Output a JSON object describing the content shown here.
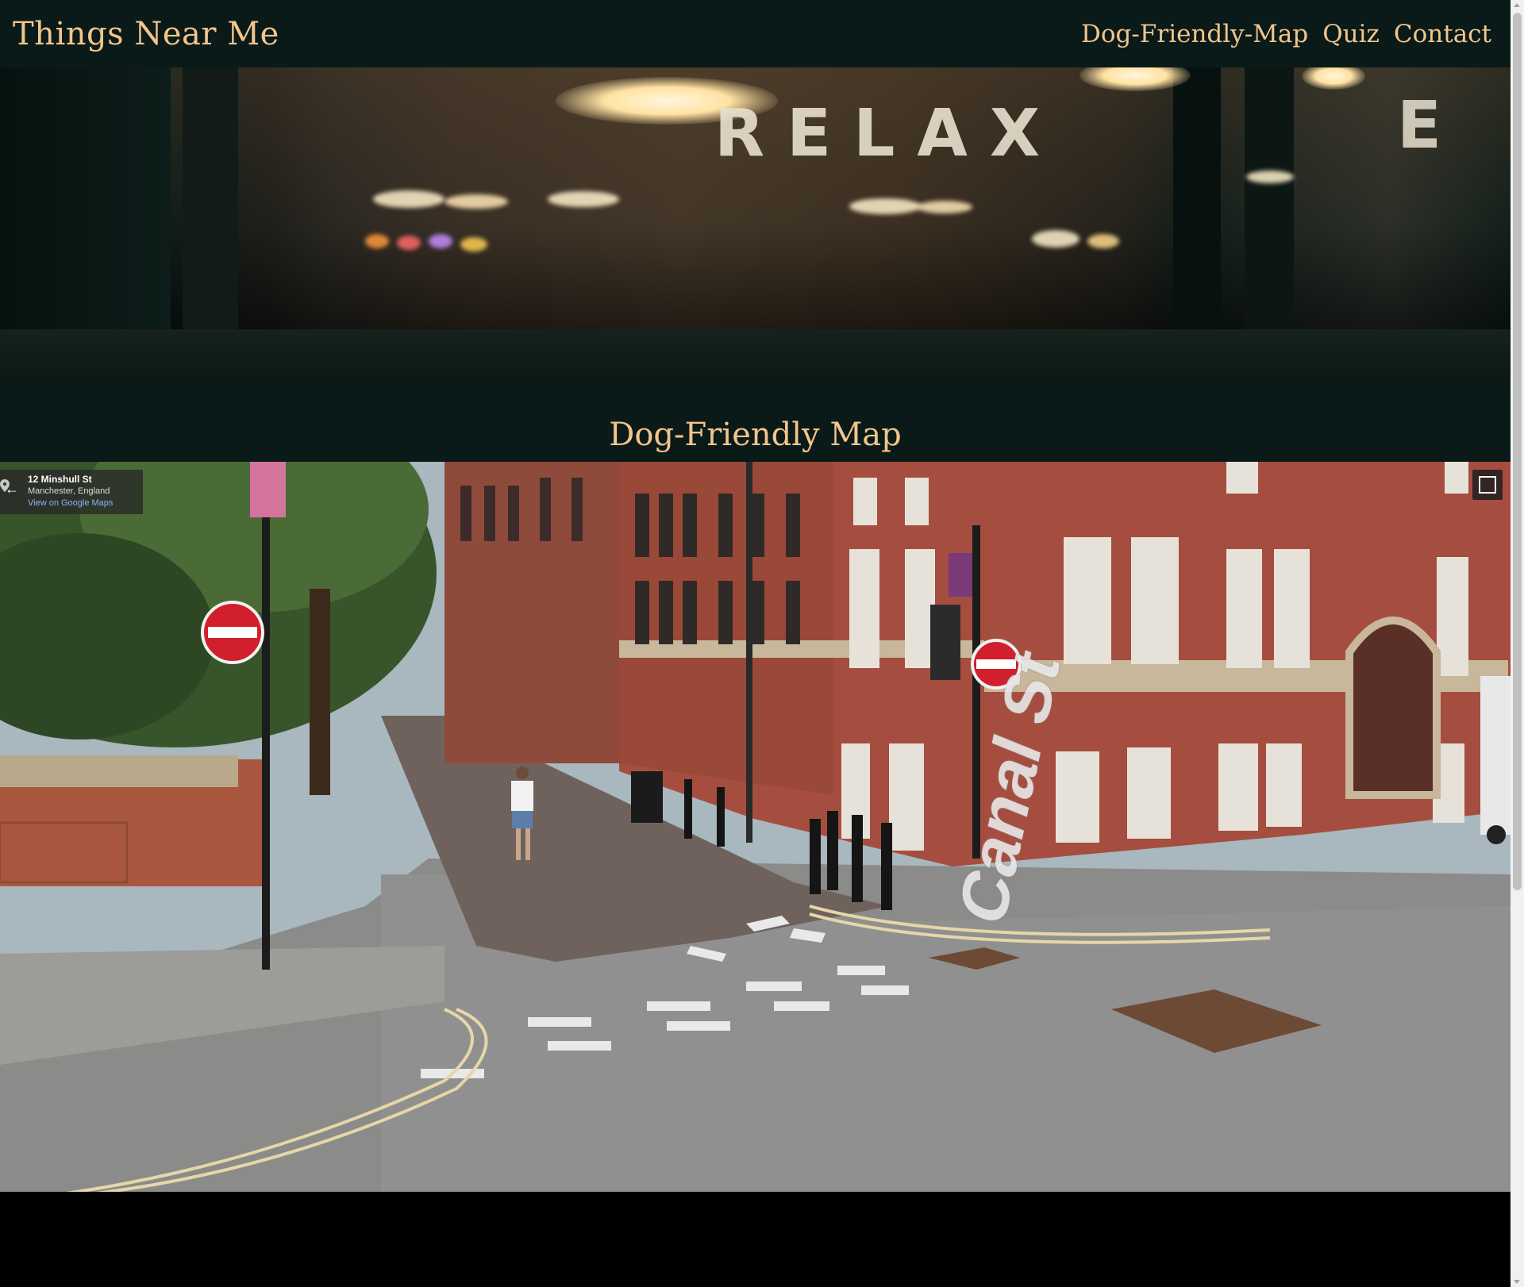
{
  "header": {
    "brand": "Things Near Me",
    "nav": [
      "Dog-Friendly-Map",
      "Quiz",
      "Contact"
    ]
  },
  "hero": {
    "sign_text": "RELAX",
    "sign_text_right": "E"
  },
  "map_section": {
    "title": "Dog-Friendly Map"
  },
  "street_view": {
    "address": "12 Minshull St",
    "city": "Manchester, England",
    "link": "View on Google Maps",
    "street_label": "Canal St"
  },
  "colors": {
    "header_bg": "#0a1a19",
    "accent": "#f2c58a",
    "page_bg": "#000000"
  },
  "icons": [
    "back-arrow-icon",
    "map-pin-icon",
    "fullscreen-icon",
    "navigation-arrow-icon"
  ]
}
